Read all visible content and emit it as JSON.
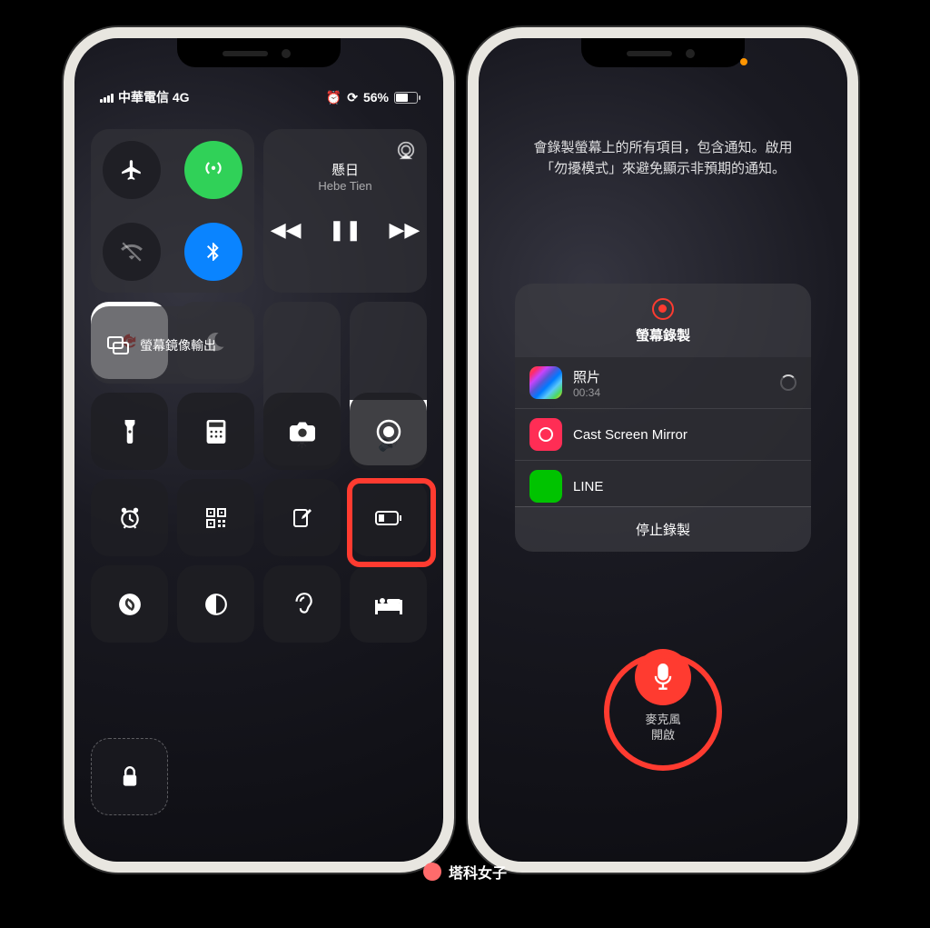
{
  "status": {
    "carrier": "中華電信 4G",
    "battery_pct": "56%"
  },
  "music": {
    "title": "懸日",
    "artist": "Hebe Tien"
  },
  "mirror": {
    "label": "螢幕鏡像輸出"
  },
  "record_info": {
    "line1": "會錄製螢幕上的所有項目，包含通知。啟用",
    "line2": "「勿擾模式」來避免顯示非預期的通知。"
  },
  "record_panel": {
    "title": "螢幕錄製",
    "items": [
      {
        "name": "照片",
        "sub": "00:34",
        "icon": "photos"
      },
      {
        "name": "Cast Screen Mirror",
        "sub": "",
        "icon": "cast"
      },
      {
        "name": "LINE",
        "sub": "",
        "icon": "line"
      }
    ],
    "stop": "停止錄製"
  },
  "mic": {
    "label1": "麥克風",
    "label2": "開啟"
  },
  "watermark": "塔科女子"
}
